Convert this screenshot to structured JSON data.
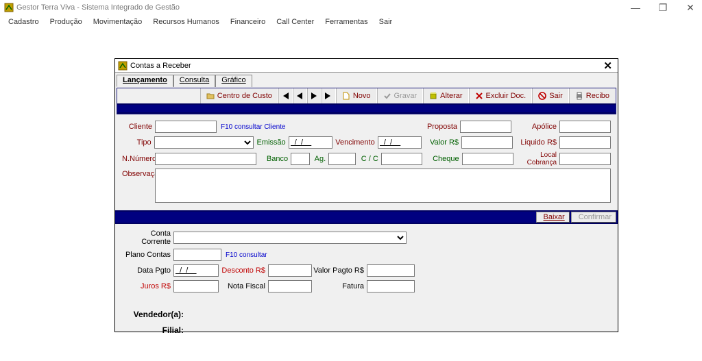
{
  "app": {
    "title": "Gestor Terra Viva - Sistema Integrado de Gestão",
    "menus": [
      "Cadastro",
      "Produção",
      "Movimentação",
      "Recursos Humanos",
      "Financeiro",
      "Call Center",
      "Ferramentas",
      "Sair"
    ]
  },
  "modal": {
    "title": "Contas a Receber",
    "tabs": {
      "lancamento": "Lançamento",
      "consulta": "Consulta",
      "grafico": "Gráfico"
    },
    "toolbar": {
      "centro_custo": "Centro de Custo",
      "novo": "Novo",
      "gravar": "Gravar",
      "alterar": "Alterar",
      "excluir": "Excluir Doc.",
      "sair": "Sair",
      "recibo": "Recibo"
    },
    "labels": {
      "cliente": "Cliente",
      "hint_cliente": "F10 consultar Cliente",
      "proposta": "Proposta",
      "apolice": "Apólice",
      "tipo": "Tipo",
      "emissao": "Emissão",
      "vencimento": "Vencimento",
      "valor": "Valor R$",
      "liquido": "Liquido R$",
      "nnumero": "N.Número",
      "banco": "Banco",
      "ag": "Ag.",
      "cc": "C / C",
      "cheque": "Cheque",
      "local_cobranca": "Local Cobrança",
      "observacao": "Observação",
      "baixar": "Baixar",
      "confirmar": "Confirmar",
      "conta_corrente": "Conta Corrente",
      "plano_contas": "Plano Contas",
      "hint_plano": "F10 consultar",
      "data_pgto": "Data Pgto",
      "desconto": "Desconto R$",
      "valor_pagto": "Valor Pagto R$",
      "juros": "Juros R$",
      "nota_fiscal": "Nota Fiscal",
      "fatura": "Fatura",
      "vendedor": "Vendedor(a):",
      "filial": "Filial:"
    },
    "values": {
      "cliente": "",
      "proposta": "",
      "apolice": "",
      "tipo": "",
      "emissao": "  /  /    ",
      "vencimento": "  /  /    ",
      "valor": "",
      "liquido": "",
      "nnumero": "",
      "banco": "",
      "ag": "",
      "cc": "",
      "cheque": "",
      "local_cobranca": "",
      "observacao": "",
      "conta_corrente": "",
      "plano_contas": "",
      "data_pgto": "  /  /    ",
      "desconto": "",
      "valor_pagto": "",
      "juros": "",
      "nota_fiscal": "",
      "fatura": ""
    }
  }
}
